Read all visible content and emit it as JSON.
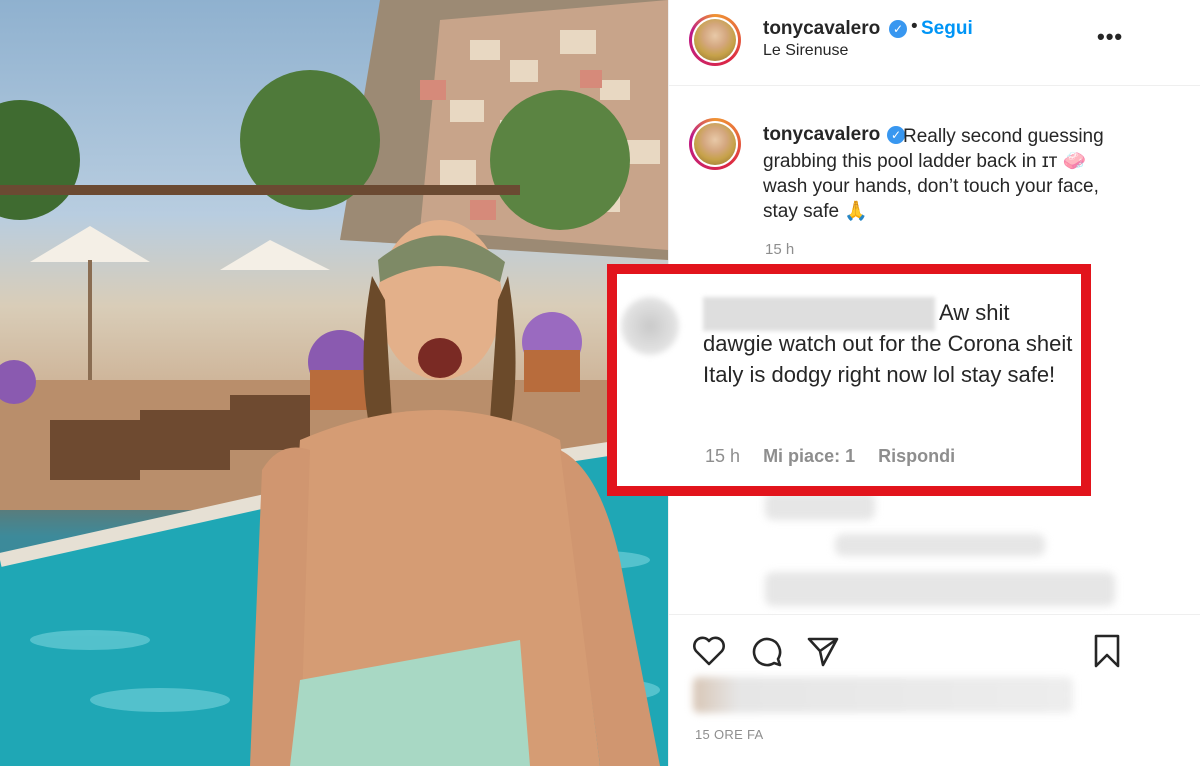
{
  "post": {
    "author": "tonycavalero",
    "follow_label": "Segui",
    "location": "Le Sirenuse",
    "caption": "Really second guessing grabbing this pool ladder back in ɪᴛ 🧼 wash your hands, don’t touch your face, stay safe 🙏",
    "caption_time": "15 h",
    "date_label": "15 ORE FA"
  },
  "highlighted_comment": {
    "text": "Aw shit dawgie watch out for the Corona sheit Italy is dodgy right now lol stay safe!",
    "time": "15 h",
    "likes": "Mi piace: 1",
    "reply_label": "Rispondi"
  },
  "icons": {
    "like": "heart-icon",
    "comment": "comment-icon",
    "share": "share-icon",
    "save": "bookmark-icon",
    "more": "more-icon"
  },
  "colors": {
    "accent": "#0095f6",
    "verified": "#3897f0",
    "highlight": "#e2141c",
    "secondary_text": "#8e8e8e"
  }
}
